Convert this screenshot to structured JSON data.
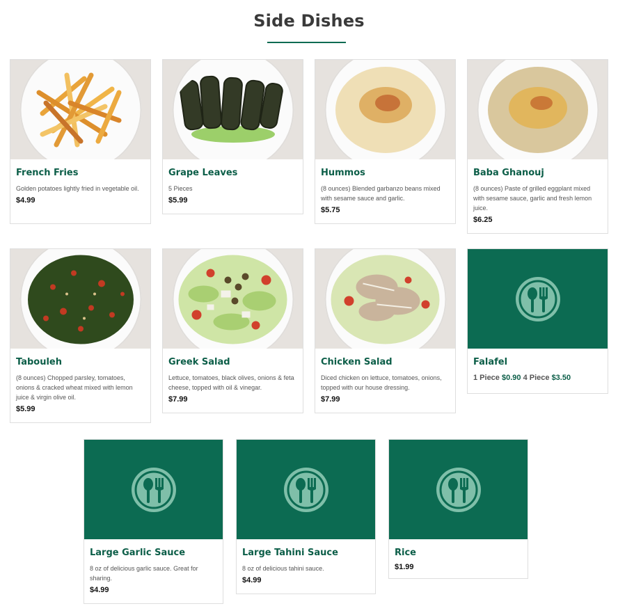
{
  "page": {
    "title": "Side Dishes",
    "accent_color": "#0c6b52"
  },
  "items": [
    {
      "name": "French Fries",
      "desc": "Golden potatoes lightly fried in vegetable oil.",
      "price": "$4.99",
      "image": "french-fries-photo"
    },
    {
      "name": "Grape Leaves",
      "desc": "5 Pieces",
      "price": "$5.99",
      "image": "grape-leaves-photo"
    },
    {
      "name": "Hummos",
      "desc": "(8 ounces) Blended garbanzo beans mixed with sesame sauce and garlic.",
      "price": "$5.75",
      "image": "hummos-photo"
    },
    {
      "name": "Baba Ghanouj",
      "desc": "(8 ounces) Paste of grilled eggplant mixed with sesame sauce, garlic and fresh lemon juice.",
      "price": "$6.25",
      "image": "baba-ghanouj-photo"
    },
    {
      "name": "Tabouleh",
      "desc": "(8 ounces) Chopped parsley, tomatoes, onions & cracked wheat mixed with lemon juice & virgin olive oil.",
      "price": "$5.99",
      "image": "tabouleh-photo"
    },
    {
      "name": "Greek Salad",
      "desc": "Lettuce, tomatoes, black olives, onions & feta cheese, topped with oil & vinegar.",
      "price": "$7.99",
      "image": "greek-salad-photo"
    },
    {
      "name": "Chicken Salad",
      "desc": "Diced chicken on lettuce, tomatoes, onions, topped with our house dressing.",
      "price": "$7.99",
      "image": "chicken-salad-photo"
    },
    {
      "name": "Falafel",
      "price_label_1": "1 Piece",
      "price_1": "$0.90",
      "price_label_2": "4 Piece",
      "price_2": "$3.50",
      "image": "utensils-placeholder-icon"
    },
    {
      "name": "Large Garlic Sauce",
      "desc": "8 oz of delicious garlic sauce. Great for sharing.",
      "price": "$4.99",
      "image": "utensils-placeholder-icon"
    },
    {
      "name": "Large Tahini Sauce",
      "desc": "8 oz of delicious tahini sauce.",
      "price": "$4.99",
      "image": "utensils-placeholder-icon"
    },
    {
      "name": "Rice",
      "price": "$1.99",
      "image": "utensils-placeholder-icon"
    }
  ]
}
